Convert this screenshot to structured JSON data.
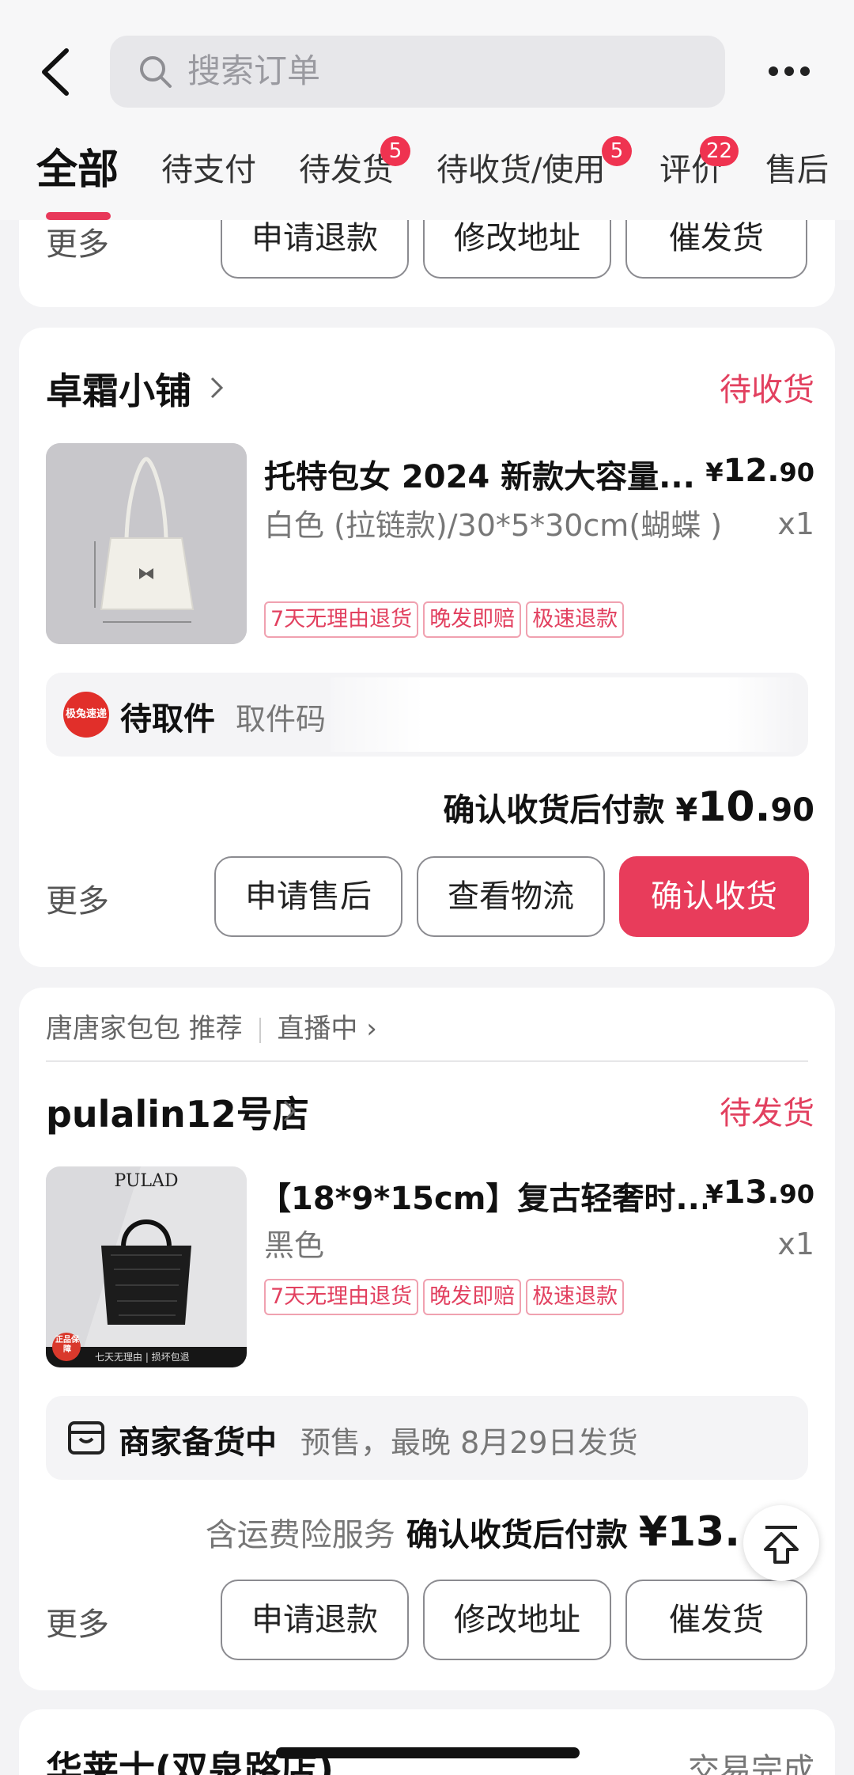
{
  "search": {
    "placeholder": "搜索订单"
  },
  "tabs": [
    {
      "label": "全部",
      "active": true
    },
    {
      "label": "待支付"
    },
    {
      "label": "待发货",
      "badge": "5"
    },
    {
      "label": "待收货/使用",
      "badge": "5"
    },
    {
      "label": "评价",
      "badge": "22"
    },
    {
      "label": "售后"
    }
  ],
  "top_partial": {
    "more": "更多",
    "buttons": [
      "申请退款",
      "修改地址",
      "催发货"
    ]
  },
  "order1": {
    "shop": "卓霜小铺",
    "status": "待收货",
    "product_title": "托特包女 2024 新款大容量...",
    "price_symbol": "¥",
    "price_int": "12.",
    "price_dec": "90",
    "spec": "白色 (拉链款)/30*5*30cm(蝴蝶 )",
    "qty": "x1",
    "tags": [
      "7天无理由退货",
      "晚发即赔",
      "极速退款"
    ],
    "logistics_logo": "极兔速递",
    "logistics_status": "待取件",
    "pickup_label": "取件码",
    "pay_label": "确认收货后付款",
    "pay_symbol": "¥",
    "pay_int": "10.",
    "pay_dec": "90",
    "more": "更多",
    "buttons": [
      "申请售后",
      "查看物流",
      "确认收货"
    ]
  },
  "order2": {
    "recommend": {
      "shop": "唐唐家包包",
      "label": "推荐",
      "live": "直播中"
    },
    "shop": "pulalin12号店",
    "status": "待发货",
    "product_title": "【18*9*15cm】复古轻奢时...",
    "thumb_brand": "PULAD",
    "thumb_footer": "七天无理由 | 损坏包退",
    "thumb_seal": "正品保障",
    "price_symbol": "¥",
    "price_int": "13.",
    "price_dec": "90",
    "spec": "黑色",
    "qty": "x1",
    "tags": [
      "7天无理由退货",
      "晚发即赔",
      "极速退款"
    ],
    "prep_status": "商家备货中",
    "prep_detail": "预售，最晚 8月29日发货",
    "insurance": "含运费险服务",
    "pay_label": "确认收货后付款",
    "pay_amount": "¥13.",
    "more": "更多",
    "buttons": [
      "申请退款",
      "修改地址",
      "催发货"
    ]
  },
  "order3": {
    "shop": "华莱士(双泉路店)",
    "status": "交易完成"
  }
}
